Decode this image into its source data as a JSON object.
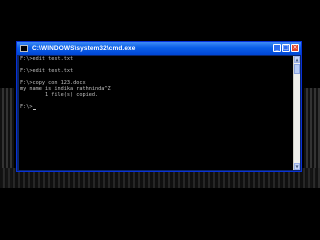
{
  "window": {
    "title": "C:\\WINDOWS\\system32\\cmd.exe",
    "buttons": {
      "minimize": "_",
      "maximize": "□",
      "close": "×"
    }
  },
  "console": {
    "lines": [
      "F:\\>edit test.txt",
      "",
      "F:\\>edit test.txt",
      "",
      "F:\\>copy con 123.docx",
      "my name is indika rathninda^Z",
      "        1 file(s) copied.",
      "",
      "F:\\>"
    ]
  },
  "colors": {
    "console_bg": "#000000",
    "console_text": "#c0c0c0",
    "titlebar": "#0a5ee8"
  }
}
